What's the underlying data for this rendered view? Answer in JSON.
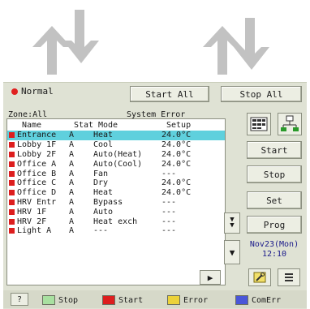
{
  "header": {
    "status_text": "Normal",
    "start_all_label": "Start All",
    "stop_all_label": "Stop All",
    "zone_label": "Zone:All",
    "system_error_label": "System Error"
  },
  "list": {
    "columns": [
      "Name",
      "Stat",
      "Mode",
      "Setup"
    ],
    "rows": [
      {
        "name": "Entrance",
        "stat": "A",
        "mode": "Heat",
        "setup": "24.0°C",
        "selected": true
      },
      {
        "name": "Lobby 1F",
        "stat": "A",
        "mode": "Cool",
        "setup": "24.0°C"
      },
      {
        "name": "Lobby 2F",
        "stat": "A",
        "mode": "Auto(Heat)",
        "setup": "24.0°C"
      },
      {
        "name": "Office A",
        "stat": "A",
        "mode": "Auto(Cool)",
        "setup": "24.0°C"
      },
      {
        "name": "Office B",
        "stat": "A",
        "mode": "Fan",
        "setup": "---"
      },
      {
        "name": "Office C",
        "stat": "A",
        "mode": "Dry",
        "setup": "24.0°C"
      },
      {
        "name": "Office D",
        "stat": "A",
        "mode": "Heat",
        "setup": "24.0°C"
      },
      {
        "name": "HRV Entr",
        "stat": "A",
        "mode": "Bypass",
        "setup": "---"
      },
      {
        "name": "HRV 1F",
        "stat": "A",
        "mode": "Auto",
        "setup": "---"
      },
      {
        "name": "HRV 2F",
        "stat": "A",
        "mode": "Heat exch",
        "setup": "---"
      },
      {
        "name": "Light A",
        "stat": "A",
        "mode": "---",
        "setup": "---"
      }
    ]
  },
  "side": {
    "start_label": "Start",
    "stop_label": "Stop",
    "set_label": "Set",
    "prog_label": "Prog",
    "date": "Nov23(Mon)",
    "time": "12:10"
  },
  "legend": {
    "help_label": "?",
    "items": [
      {
        "label": "Stop",
        "color": "#a8e0a0"
      },
      {
        "label": "Start",
        "color": "#dd1e1e"
      },
      {
        "label": "Error",
        "color": "#ecd23a"
      },
      {
        "label": "ComErr",
        "color": "#4a56d8"
      }
    ]
  },
  "colors": {
    "panel": "#dfe2d4",
    "selected_row": "#5fd0dd",
    "status_dot": "#e02020",
    "arrows": "#bdbdbd"
  }
}
